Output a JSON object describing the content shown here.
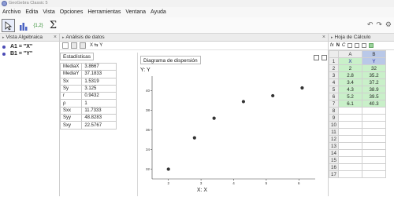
{
  "window": {
    "title": "GeoGebra Classic 5"
  },
  "menu": [
    "Archivo",
    "Edita",
    "Vista",
    "Opciones",
    "Herramientas",
    "Ventana",
    "Ayuda"
  ],
  "toolbar": {
    "tools": [
      "move-tool",
      "one-variable-analysis-tool",
      "two-variable-regression-tool",
      "sum-tool"
    ],
    "regression_icon_text": "{1,2}"
  },
  "algebra": {
    "title": "Vista Algebraica",
    "items": [
      {
        "text": "A1 = \"X\""
      },
      {
        "text": "B1 = \"Y\""
      }
    ]
  },
  "analysis": {
    "title": "Análisis de datos",
    "toolbar_label": "X ⇆ Y",
    "stats_tab": "Estadísticas",
    "stats": [
      {
        "k": "MediaX",
        "v": "3.8667"
      },
      {
        "k": "MediaY",
        "v": "37.1833"
      },
      {
        "k": "Sx",
        "v": "1.5319"
      },
      {
        "k": "Sy",
        "v": "3.125"
      },
      {
        "k": "r",
        "v": "0.9432"
      },
      {
        "k": "ρ",
        "v": "1"
      },
      {
        "k": "Sxx",
        "v": "11.7333"
      },
      {
        "k": "Syy",
        "v": "48.8283"
      },
      {
        "k": "Sxy",
        "v": "22.5767"
      }
    ],
    "plot_selector": "Diagrama de dispersión"
  },
  "chart_data": {
    "type": "scatter",
    "title": "",
    "xlabel": "X: X",
    "ylabel": "Y: Y",
    "x": [
      2,
      2.8,
      3.4,
      4.3,
      5.2,
      6.1
    ],
    "y": [
      32,
      35.2,
      37.2,
      38.9,
      39.5,
      40.3
    ],
    "xlim": [
      1.5,
      6.5
    ],
    "ylim": [
      31,
      41.5
    ],
    "xticks": [
      "2",
      "3",
      "4",
      "5",
      "6"
    ],
    "yticks": [
      "32",
      "34",
      "36",
      "38",
      "40"
    ],
    "point_color": "#333333"
  },
  "sheet": {
    "title": "Hoja de Cálculo",
    "formula_icon": "fx",
    "bold_btn": "N",
    "italic_btn": "C",
    "columns": [
      "A",
      "B"
    ],
    "rows": [
      [
        "X",
        "Y"
      ],
      [
        "2",
        "32"
      ],
      [
        "2.8",
        "35.2"
      ],
      [
        "3.4",
        "37.2"
      ],
      [
        "4.3",
        "38.9"
      ],
      [
        "5.2",
        "39.5"
      ],
      [
        "6.1",
        "40.3"
      ],
      [
        "",
        ""
      ],
      [
        "",
        ""
      ],
      [
        "",
        ""
      ],
      [
        "",
        ""
      ],
      [
        "",
        ""
      ],
      [
        "",
        ""
      ],
      [
        "",
        ""
      ],
      [
        "",
        ""
      ],
      [
        "",
        ""
      ],
      [
        "",
        ""
      ]
    ],
    "row_numbers": [
      "1",
      "2",
      "3",
      "4",
      "5",
      "6",
      "7",
      "8",
      "9",
      "10",
      "11",
      "12",
      "13",
      "14",
      "15",
      "16",
      "17"
    ]
  }
}
